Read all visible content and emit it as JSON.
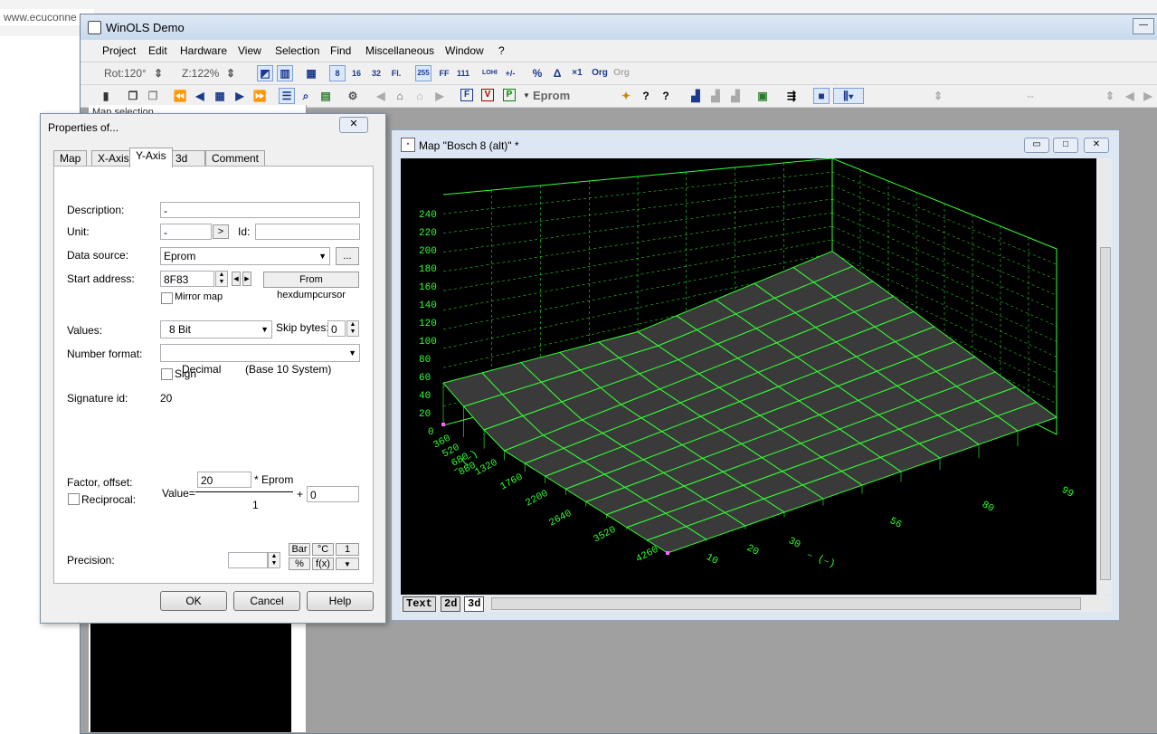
{
  "browser": {
    "url": "www.ecuconne"
  },
  "app": {
    "title": "WinOLS Demo",
    "min": "—"
  },
  "menu": [
    "Project",
    "Edit",
    "Hardware",
    "View",
    "Selection",
    "Find",
    "Miscellaneous",
    "Window",
    "?"
  ],
  "toolbar1": {
    "rot": "Rot:120°",
    "zoom": "Z:122%",
    "b8": "8",
    "b16": "16",
    "b32": "32",
    "bfl": "Fl.",
    "b255": "255",
    "bff": "FF",
    "b111": "111",
    "lohi": "LOHI",
    "pm": "+/-",
    "pct": "%",
    "delta": "Δ",
    "x1": "×1",
    "org": "Org",
    "org2": "Org"
  },
  "toolbar2": {
    "eprom": "Eprom",
    "f": "F",
    "v": "V",
    "p": "P"
  },
  "left_pane": {
    "header": "Map selection"
  },
  "dialog": {
    "title": "Properties of...",
    "close": "✕",
    "tabs": [
      "Map",
      "X-Axis",
      "Y-Axis",
      "3d",
      "Comment"
    ],
    "active_tab": "Y-Axis",
    "description_label": "Description:",
    "description_value": "-",
    "unit_label": "Unit:",
    "unit_value": "-",
    "unit_btn": ">",
    "id_label": "Id:",
    "id_value": "",
    "datasource_label": "Data source:",
    "datasource_value": "Eprom",
    "datasource_btn": "...",
    "start_label": "Start address:",
    "start_value": "8F83",
    "hexdump_btn": "From hexdumpcursor",
    "mirror_label": "Mirror map",
    "values_label": "Values:",
    "values_value": "8 Bit",
    "skip_label": "Skip bytes:",
    "skip_value": "0",
    "numfmt_label": "Number format:",
    "numfmt_value": "Decimal        (Base 10 System)",
    "sign_label": "Sign",
    "sigid_label": "Signature id:",
    "sigid_value": "20",
    "factor_label": "Factor, offset:",
    "reciprocal_label": "Reciprocal:",
    "value_eq": "Value=",
    "factor_value": "20",
    "eprom_suffix": "* Eprom",
    "divisor": "1",
    "plus": "+",
    "offset_value": "0",
    "precision_label": "Precision:",
    "precision_value": "",
    "unit_btns": [
      "Bar",
      "°C",
      "1",
      "%",
      "f(x)",
      "▼"
    ],
    "ok": "OK",
    "cancel": "Cancel",
    "help": "Help"
  },
  "map_window": {
    "title": "Map \"Bosch  8 (alt)\" *",
    "min": "▭",
    "max": "□",
    "close": "✕",
    "tabs": [
      "Text",
      "2d",
      "3d"
    ],
    "active_tab": "3d"
  },
  "chart_data": {
    "type": "surface3d",
    "z_ticks": [
      "0",
      "20",
      "40",
      "60",
      "80",
      "100",
      "120",
      "140",
      "160",
      "180",
      "200",
      "220",
      "240"
    ],
    "y_ticks": [
      "360",
      "520",
      "680",
      "880",
      "1320",
      "1760",
      "2200",
      "2640",
      "3520",
      "4260"
    ],
    "x_ticks": [
      "10",
      "20",
      "30",
      "56",
      "80",
      "99"
    ],
    "x_label": "– (–)",
    "y_label": "– (–)",
    "grid": true,
    "surface_color": "#3a3a3a",
    "line_color": "#33ff33"
  },
  "colors": {
    "grid": "#33ff33",
    "plot_bg": "#000000"
  }
}
